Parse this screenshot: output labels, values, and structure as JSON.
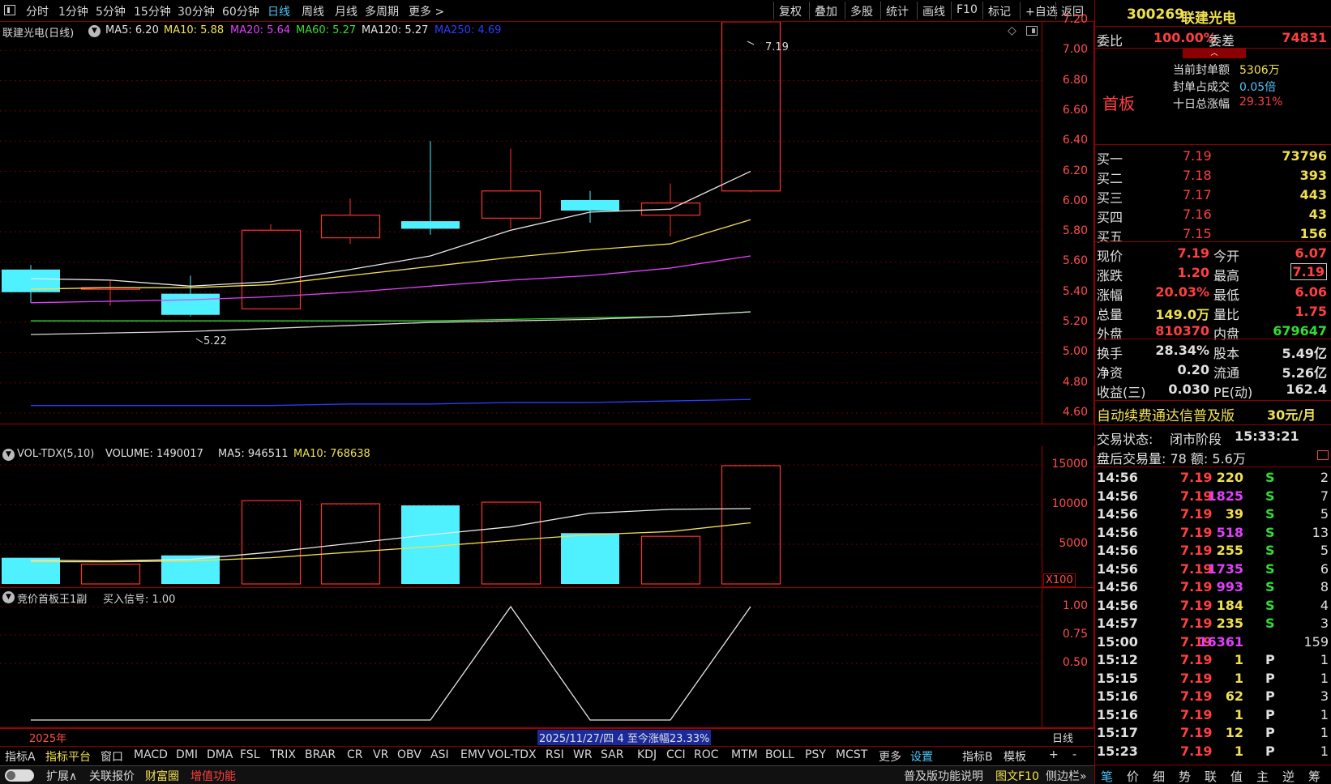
{
  "toolbar": {
    "periods": [
      "分时",
      "1分钟",
      "5分钟",
      "15分钟",
      "30分钟",
      "60分钟",
      "日线",
      "周线",
      "月线",
      "多周期",
      "更多 >"
    ],
    "active_period": "日线",
    "right_buttons": [
      "复权",
      "叠加",
      "多股",
      "统计",
      "画线",
      "F10",
      "标记",
      "+自选",
      "返回"
    ]
  },
  "main_chart": {
    "title": "联建光电(日线)",
    "ma": [
      {
        "label": "MA5: 6.20",
        "color": "#e0e0e0"
      },
      {
        "label": "MA10: 5.88",
        "color": "#f0e050"
      },
      {
        "label": "MA20: 5.64",
        "color": "#e040fb"
      },
      {
        "label": "MA60: 5.27",
        "color": "#33dd33"
      },
      {
        "label": "MA120: 5.27",
        "color": "#e0e0e0"
      },
      {
        "label": "MA250: 4.69",
        "color": "#2a3dff"
      }
    ],
    "high_marker": "7.19",
    "low_marker": "5.22",
    "y_ticks": [
      "7.20",
      "7.00",
      "6.80",
      "6.60",
      "6.40",
      "6.20",
      "6.00",
      "5.80",
      "5.60",
      "5.40",
      "5.20",
      "5.00",
      "4.80",
      "4.60"
    ],
    "candles": [
      {
        "o": 5.55,
        "c": 5.4,
        "h": 5.58,
        "l": 5.33
      },
      {
        "o": 5.43,
        "c": 5.43,
        "h": 5.48,
        "l": 5.31
      },
      {
        "o": 5.39,
        "c": 5.25,
        "h": 5.51,
        "l": 5.24
      },
      {
        "o": 5.29,
        "c": 5.81,
        "h": 5.85,
        "l": 5.29
      },
      {
        "o": 5.76,
        "c": 5.91,
        "h": 6.02,
        "l": 5.72
      },
      {
        "o": 5.87,
        "c": 5.82,
        "h": 6.4,
        "l": 5.78
      },
      {
        "o": 5.89,
        "c": 6.07,
        "h": 6.35,
        "l": 5.82
      },
      {
        "o": 6.01,
        "c": 5.94,
        "h": 6.07,
        "l": 5.86
      },
      {
        "o": 5.91,
        "c": 5.99,
        "h": 6.12,
        "l": 5.77
      },
      {
        "o": 6.07,
        "c": 7.19,
        "h": 7.19,
        "l": 6.06
      }
    ],
    "ma5": [
      5.49,
      5.48,
      5.44,
      5.47,
      5.55,
      5.64,
      5.81,
      5.93,
      5.95,
      6.2
    ],
    "ma10": [
      5.42,
      5.43,
      5.43,
      5.45,
      5.51,
      5.57,
      5.63,
      5.68,
      5.72,
      5.88
    ],
    "ma20": [
      5.33,
      5.34,
      5.35,
      5.37,
      5.4,
      5.44,
      5.48,
      5.51,
      5.56,
      5.64
    ],
    "ma60": [
      5.21,
      5.21,
      5.21,
      5.21,
      5.21,
      5.21,
      5.22,
      5.23,
      5.24,
      5.27
    ],
    "ma120": [
      5.12,
      5.13,
      5.14,
      5.16,
      5.18,
      5.2,
      5.21,
      5.22,
      5.24,
      5.27
    ],
    "ma250": [
      4.65,
      4.65,
      4.65,
      4.65,
      4.66,
      4.66,
      4.67,
      4.67,
      4.68,
      4.69
    ]
  },
  "volume_chart": {
    "title": "VOL-TDX(5,10)",
    "labels": [
      {
        "label": "VOLUME: 1490017",
        "color": "#e0e0e0"
      },
      {
        "label": "MA5: 946511",
        "color": "#e0e0e0"
      },
      {
        "label": "MA10: 768638",
        "color": "#f0e050"
      }
    ],
    "y_ticks": [
      "15000",
      "10000",
      "5000"
    ],
    "unit": "X100",
    "bars": [
      3300,
      2500,
      3600,
      10500,
      10100,
      9900,
      10300,
      6400,
      6000,
      14900
    ],
    "up": [
      false,
      true,
      false,
      true,
      true,
      false,
      true,
      false,
      true,
      true
    ],
    "ma5": [
      3000,
      2900,
      3100,
      4000,
      5100,
      6200,
      7200,
      8900,
      9400,
      9500
    ],
    "ma10": [
      2800,
      2800,
      2900,
      3300,
      4000,
      4700,
      5500,
      6200,
      6600,
      7700
    ]
  },
  "indicator_chart": {
    "title": "竞价首板王1副",
    "signal_label": "买入信号: 1.00",
    "y_ticks": [
      "1.00",
      "0.75",
      "0.50"
    ],
    "values": [
      0,
      0,
      0,
      0,
      0,
      0,
      1,
      0,
      0,
      1
    ]
  },
  "x_axis": {
    "year_label": "2025年",
    "info_label": "2025/11/27/四 4 至今涨幅23.33%",
    "period_label": "日线"
  },
  "bottom_tabs": [
    "指标A",
    "指标平台",
    "窗口",
    "MACD",
    "DMI",
    "DMA",
    "FSL",
    "TRIX",
    "BRAR",
    "CR",
    "VR",
    "OBV",
    "ASI",
    "EMV",
    "VOL-TDX",
    "RSI",
    "WR",
    "SAR",
    "KDJ",
    "CCI",
    "ROC",
    "MTM",
    "BOLL",
    "PSY",
    "MCST",
    "更多",
    "设置",
    "指标B",
    "模板",
    "+",
    "-"
  ],
  "status_bar": {
    "expand": "扩展∧",
    "items": [
      "关联报价",
      "财富圈",
      "增值功能"
    ],
    "right_items": [
      "普及版功能说明",
      "图文F10",
      "侧边栏»"
    ]
  },
  "quote_panel": {
    "code": "300269",
    "name": "联建光电",
    "weibi_label": "委比",
    "weibi_value": "100.00%",
    "weicha_label": "委差",
    "weicha_value": "74831",
    "board_label": "首板",
    "seal_amount_label": "当前封单额",
    "seal_amount_value": "5306万",
    "seal_ratio_label": "封单占成交",
    "seal_ratio_value": "0.05倍",
    "ten_day_label": "十日总涨幅",
    "ten_day_value": "29.31%",
    "bids": [
      {
        "label": "买一",
        "price": "7.19",
        "vol": "73796"
      },
      {
        "label": "买二",
        "price": "7.18",
        "vol": "393"
      },
      {
        "label": "买三",
        "price": "7.17",
        "vol": "443"
      },
      {
        "label": "买四",
        "price": "7.16",
        "vol": "43"
      },
      {
        "label": "买五",
        "price": "7.15",
        "vol": "156"
      }
    ],
    "stats_left": [
      {
        "label": "现价",
        "value": "7.19",
        "color": "#ff4040"
      },
      {
        "label": "涨跌",
        "value": "1.20",
        "color": "#ff4040"
      },
      {
        "label": "涨幅",
        "value": "20.03%",
        "color": "#ff4040"
      },
      {
        "label": "总量",
        "value": "149.0万",
        "color": "#f0e050"
      },
      {
        "label": "外盘",
        "value": "810370",
        "color": "#ff4040"
      }
    ],
    "stats_right": [
      {
        "label": "今开",
        "value": "6.07",
        "color": "#ff4040"
      },
      {
        "label": "最高",
        "value": "7.19",
        "color": "#ff4040"
      },
      {
        "label": "最低",
        "value": "6.06",
        "color": "#ff4040"
      },
      {
        "label": "量比",
        "value": "1.75",
        "color": "#ff4040"
      },
      {
        "label": "内盘",
        "value": "679647",
        "color": "#33dd33"
      }
    ],
    "fin_left": [
      {
        "label": "换手",
        "value": "28.34%"
      },
      {
        "label": "净资",
        "value": "0.20"
      },
      {
        "label": "收益(三)",
        "value": "0.030"
      }
    ],
    "fin_right": [
      {
        "label": "股本",
        "value": "5.49亿"
      },
      {
        "label": "流通",
        "value": "5.26亿"
      },
      {
        "label": "PE(动)",
        "value": "162.4"
      }
    ],
    "promo": "自动续费通达信普及版",
    "promo_price": "30元/月",
    "trade_status_label": "交易状态:",
    "trade_status_value": "闭市阶段",
    "trade_time": "15:33:21",
    "after_hours": "盘后交易量: 78  额: 5.6万",
    "ticks": [
      {
        "t": "14:56",
        "p": "7.19",
        "v": "220",
        "vc": "#f0e050",
        "s": "S",
        "n": "2"
      },
      {
        "t": "14:56",
        "p": "7.19",
        "v": "1825",
        "vc": "#e040fb",
        "s": "S",
        "n": "7"
      },
      {
        "t": "14:56",
        "p": "7.19",
        "v": "39",
        "vc": "#f0e050",
        "s": "S",
        "n": "5"
      },
      {
        "t": "14:56",
        "p": "7.19",
        "v": "518",
        "vc": "#e040fb",
        "s": "S",
        "n": "13"
      },
      {
        "t": "14:56",
        "p": "7.19",
        "v": "255",
        "vc": "#f0e050",
        "s": "S",
        "n": "5"
      },
      {
        "t": "14:56",
        "p": "7.19",
        "v": "1735",
        "vc": "#e040fb",
        "s": "S",
        "n": "6"
      },
      {
        "t": "14:56",
        "p": "7.19",
        "v": "993",
        "vc": "#e040fb",
        "s": "S",
        "n": "8"
      },
      {
        "t": "14:56",
        "p": "7.19",
        "v": "184",
        "vc": "#f0e050",
        "s": "S",
        "n": "4"
      },
      {
        "t": "14:57",
        "p": "7.19",
        "v": "235",
        "vc": "#f0e050",
        "s": "S",
        "n": "3"
      },
      {
        "t": "15:00",
        "p": "7.19",
        "v": "16361",
        "vc": "#e040fb",
        "s": "",
        "n": "159"
      },
      {
        "t": "15:12",
        "p": "7.19",
        "v": "1",
        "vc": "#f0e050",
        "s": "P",
        "n": "1"
      },
      {
        "t": "15:15",
        "p": "7.19",
        "v": "1",
        "vc": "#f0e050",
        "s": "P",
        "n": "1"
      },
      {
        "t": "15:16",
        "p": "7.19",
        "v": "62",
        "vc": "#f0e050",
        "s": "P",
        "n": "3"
      },
      {
        "t": "15:16",
        "p": "7.19",
        "v": "1",
        "vc": "#f0e050",
        "s": "P",
        "n": "1"
      },
      {
        "t": "15:17",
        "p": "7.19",
        "v": "12",
        "vc": "#f0e050",
        "s": "P",
        "n": "1"
      },
      {
        "t": "15:23",
        "p": "7.19",
        "v": "1",
        "vc": "#f0e050",
        "s": "P",
        "n": "1"
      }
    ],
    "bottom_tabs": [
      "笔",
      "价",
      "细",
      "势",
      "联",
      "值",
      "主",
      "逆",
      "筹"
    ]
  }
}
